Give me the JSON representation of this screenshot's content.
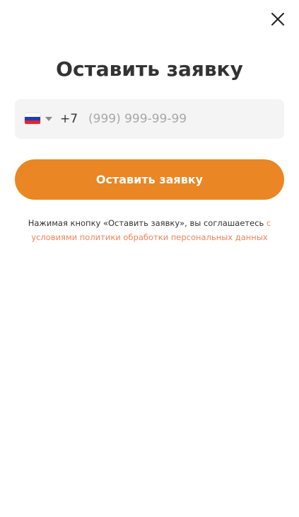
{
  "dialog": {
    "title": "Оставить заявку",
    "close_icon": "close-icon"
  },
  "phone": {
    "country_flag": "russia-flag-icon",
    "flag_colors": [
      "#ffffff",
      "#1c3fb8",
      "#e0262b"
    ],
    "dial_code": "+7",
    "placeholder": "(999) 999-99-99",
    "value": ""
  },
  "submit": {
    "label": "Оставить заявку",
    "color": "#ea8623"
  },
  "consent": {
    "text": "Нажимая кнопку «Оставить заявку», вы соглашаетесь ",
    "link_text": "с условиями политики обработки персональных данных",
    "link_color": "#f0845a"
  }
}
